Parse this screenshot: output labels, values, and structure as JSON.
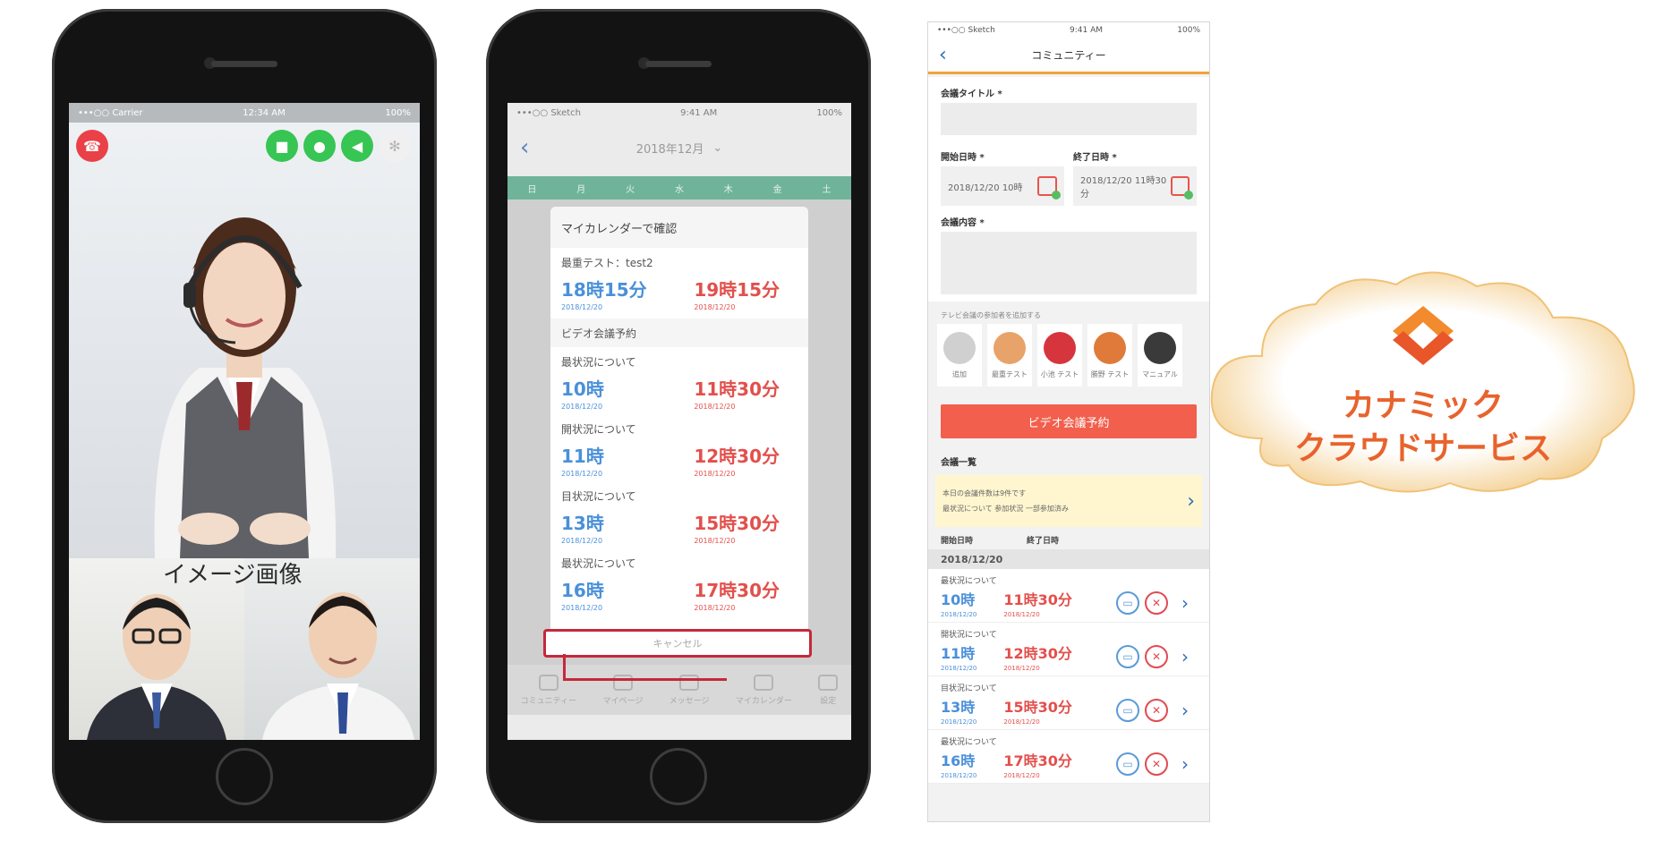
{
  "phone1": {
    "status": {
      "carrier": "•••○○ Carrier",
      "time": "12:34 AM",
      "battery": "100%"
    },
    "caption": "イメージ画像"
  },
  "phone2": {
    "status": {
      "carrier": "•••○○ Sketch",
      "time": "9:41 AM",
      "battery": "100%"
    },
    "nav_title": "2018年12月",
    "weekdays": [
      "日",
      "月",
      "火",
      "水",
      "木",
      "金",
      "土"
    ],
    "modal": {
      "title": "マイカレンダーで確認",
      "top": {
        "label": "最重テスト：test2",
        "start": "18時15分",
        "start_date": "2018/12/20",
        "end": "19時15分",
        "end_date": "2018/12/20"
      },
      "section": "ビデオ会議予約",
      "items": [
        {
          "label": "最状況について",
          "start": "10時",
          "start_date": "2018/12/20",
          "end": "11時30分",
          "end_date": "2018/12/20"
        },
        {
          "label": "開状況について",
          "start": "11時",
          "start_date": "2018/12/20",
          "end": "12時30分",
          "end_date": "2018/12/20"
        },
        {
          "label": "目状況について",
          "start": "13時",
          "start_date": "2018/12/20",
          "end": "15時30分",
          "end_date": "2018/12/20"
        },
        {
          "label": "最状況について",
          "start": "16時",
          "start_date": "2018/12/20",
          "end": "17時30分",
          "end_date": "2018/12/20"
        }
      ],
      "cancel": "キャンセル"
    },
    "tabs": [
      "コミュニティー",
      "マイページ",
      "メッセージ",
      "マイカレンダー",
      "設定"
    ]
  },
  "phone3": {
    "status": {
      "carrier": "•••○○ Sketch",
      "time": "9:41 AM",
      "battery": "100%"
    },
    "nav_title": "コミュニティー",
    "title_label": "会議タイトル *",
    "start_label": "開始日時 *",
    "end_label": "終了日時 *",
    "start_value": "2018/12/20 10時",
    "end_value": "2018/12/20 11時30分",
    "content_label": "会議内容 *",
    "members_hint": "テレビ会議の参加者を追加する",
    "members": [
      "追加",
      "最重テスト",
      "小池 テスト",
      "勝野 テスト",
      "マニュアル"
    ],
    "reserve_button": "ビデオ会議予約",
    "list_title": "会議一覧",
    "notice": {
      "text": "本日の会議件数は9件です",
      "detail": "最状況について 参加状況 一部参加済み"
    },
    "col_start": "開始日時",
    "col_end": "終了日時",
    "date_band": "2018/12/20",
    "meetings": [
      {
        "label": "最状況について",
        "start": "10時",
        "start_date": "2018/12/20",
        "end": "11時30分",
        "end_date": "2018/12/20"
      },
      {
        "label": "開状況について",
        "start": "11時",
        "start_date": "2018/12/20",
        "end": "12時30分",
        "end_date": "2018/12/20"
      },
      {
        "label": "目状況について",
        "start": "13時",
        "start_date": "2018/12/20",
        "end": "15時30分",
        "end_date": "2018/12/20"
      },
      {
        "label": "最状況について",
        "start": "16時",
        "start_date": "2018/12/20",
        "end": "17時30分",
        "end_date": "2018/12/20"
      }
    ]
  },
  "cloud": {
    "line1": "カナミック",
    "line2": "クラウドサービス"
  },
  "colors": {
    "accent_blue": "#4a90d9",
    "accent_red": "#e2504c",
    "brand_orange": "#e8632c",
    "highlight_red": "#c5283b"
  }
}
